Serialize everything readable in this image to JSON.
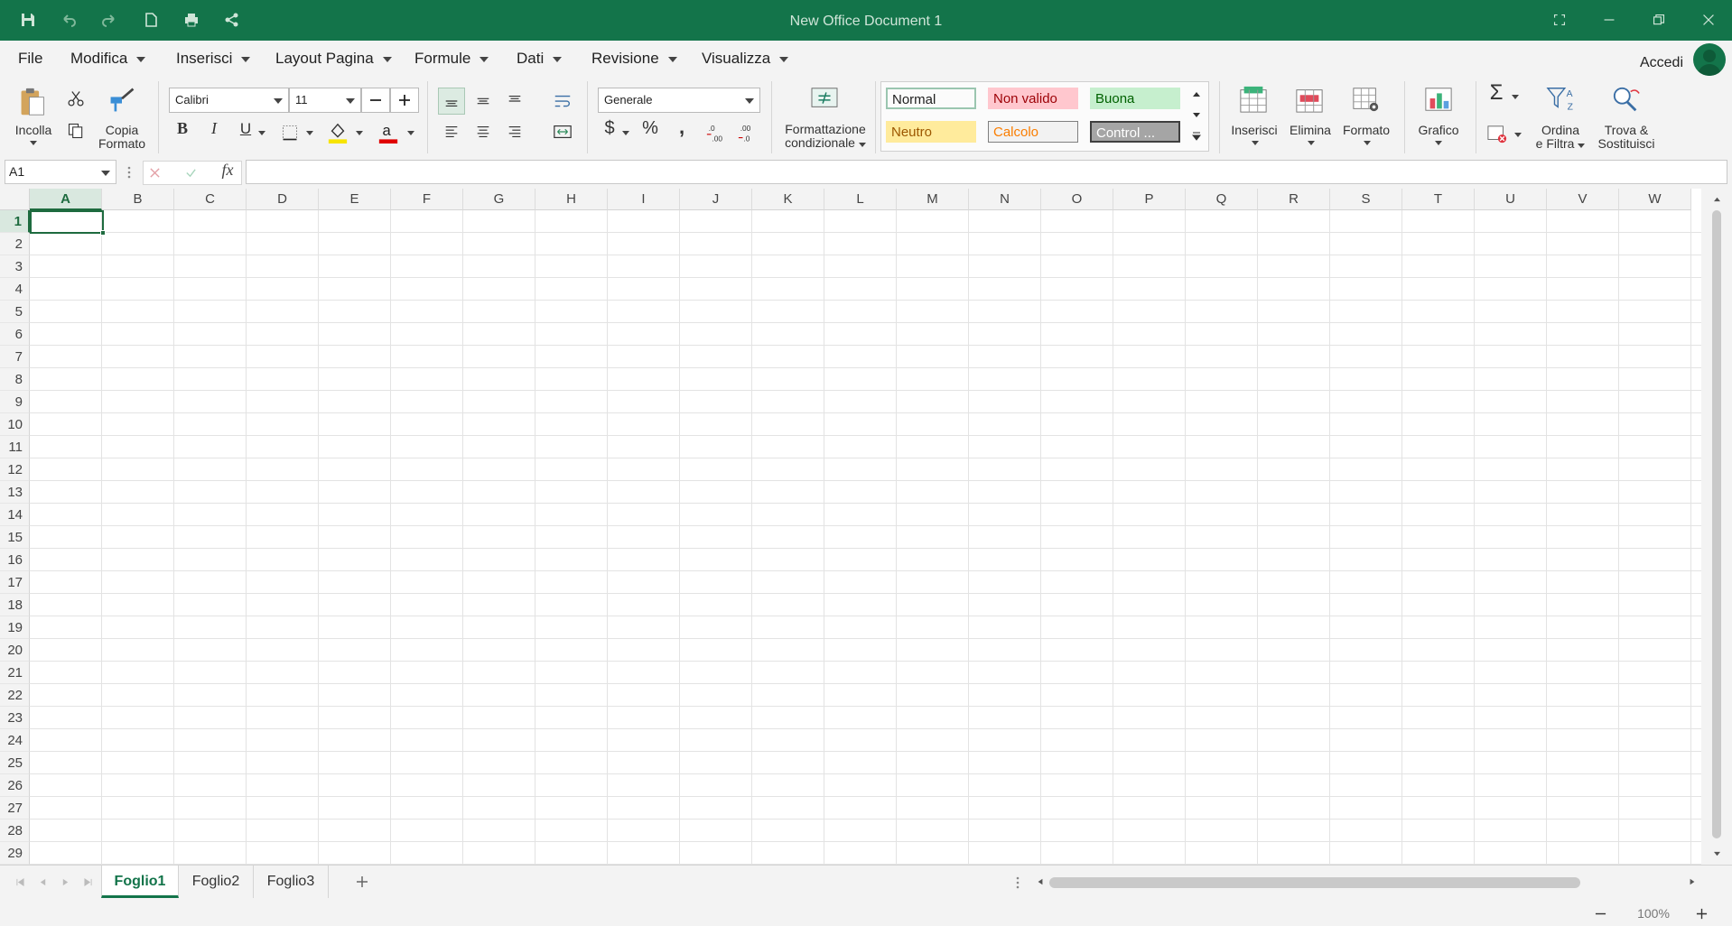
{
  "window": {
    "title": "New Office Document 1"
  },
  "menu": {
    "items": [
      "File",
      "Modifica",
      "Inserisci",
      "Layout Pagina",
      "Formule",
      "Dati",
      "Revisione",
      "Visualizza"
    ],
    "signin": "Accedi"
  },
  "ribbon": {
    "paste": "Incolla",
    "format_painter_1": "Copia",
    "format_painter_2": "Formato",
    "font": "Calibri",
    "font_size": "11",
    "number_format": "Generale",
    "conditional_1": "Formattazione",
    "conditional_2": "condizionale",
    "styles": [
      {
        "label": "Normal",
        "bg": "#ffffff",
        "fg": "#111111"
      },
      {
        "label": "Non valido",
        "bg": "#ffc7ce",
        "fg": "#9c0006"
      },
      {
        "label": "Buona",
        "bg": "#c6efce",
        "fg": "#006100"
      },
      {
        "label": "Neutro",
        "bg": "#ffeb9c",
        "fg": "#9c5700"
      },
      {
        "label": "Calcolo",
        "bg": "#f2f2f2",
        "fg": "#fa7d00"
      },
      {
        "label": "Control ...",
        "bg": "#a5a5a5",
        "fg": "#ffffff"
      }
    ],
    "insert": "Inserisci",
    "delete": "Elimina",
    "format": "Formato",
    "chart": "Grafico",
    "sort_1": "Ordina",
    "sort_2": "e Filtra",
    "find_1": "Trova &",
    "find_2": "Sostituisci"
  },
  "formula_bar": {
    "name_box": "A1",
    "fx": "fx",
    "value": ""
  },
  "sheet": {
    "columns": [
      "A",
      "B",
      "C",
      "D",
      "E",
      "F",
      "G",
      "H",
      "I",
      "J",
      "K",
      "L",
      "M",
      "N",
      "O",
      "P",
      "Q",
      "R",
      "S",
      "T",
      "U",
      "V",
      "W"
    ],
    "rows": [
      "1",
      "2",
      "3",
      "4",
      "5",
      "6",
      "7",
      "8",
      "9",
      "10",
      "11",
      "12",
      "13",
      "14",
      "15",
      "16",
      "17",
      "18",
      "19",
      "20",
      "21",
      "22",
      "23",
      "24",
      "25",
      "26",
      "27",
      "28",
      "29"
    ],
    "active_cell": "A1"
  },
  "tabs": [
    "Foglio1",
    "Foglio2",
    "Foglio3"
  ],
  "active_tab": "Foglio1",
  "status": {
    "zoom": "100%"
  },
  "colors": {
    "brand": "#13744a",
    "active": "#1e6b3f"
  }
}
